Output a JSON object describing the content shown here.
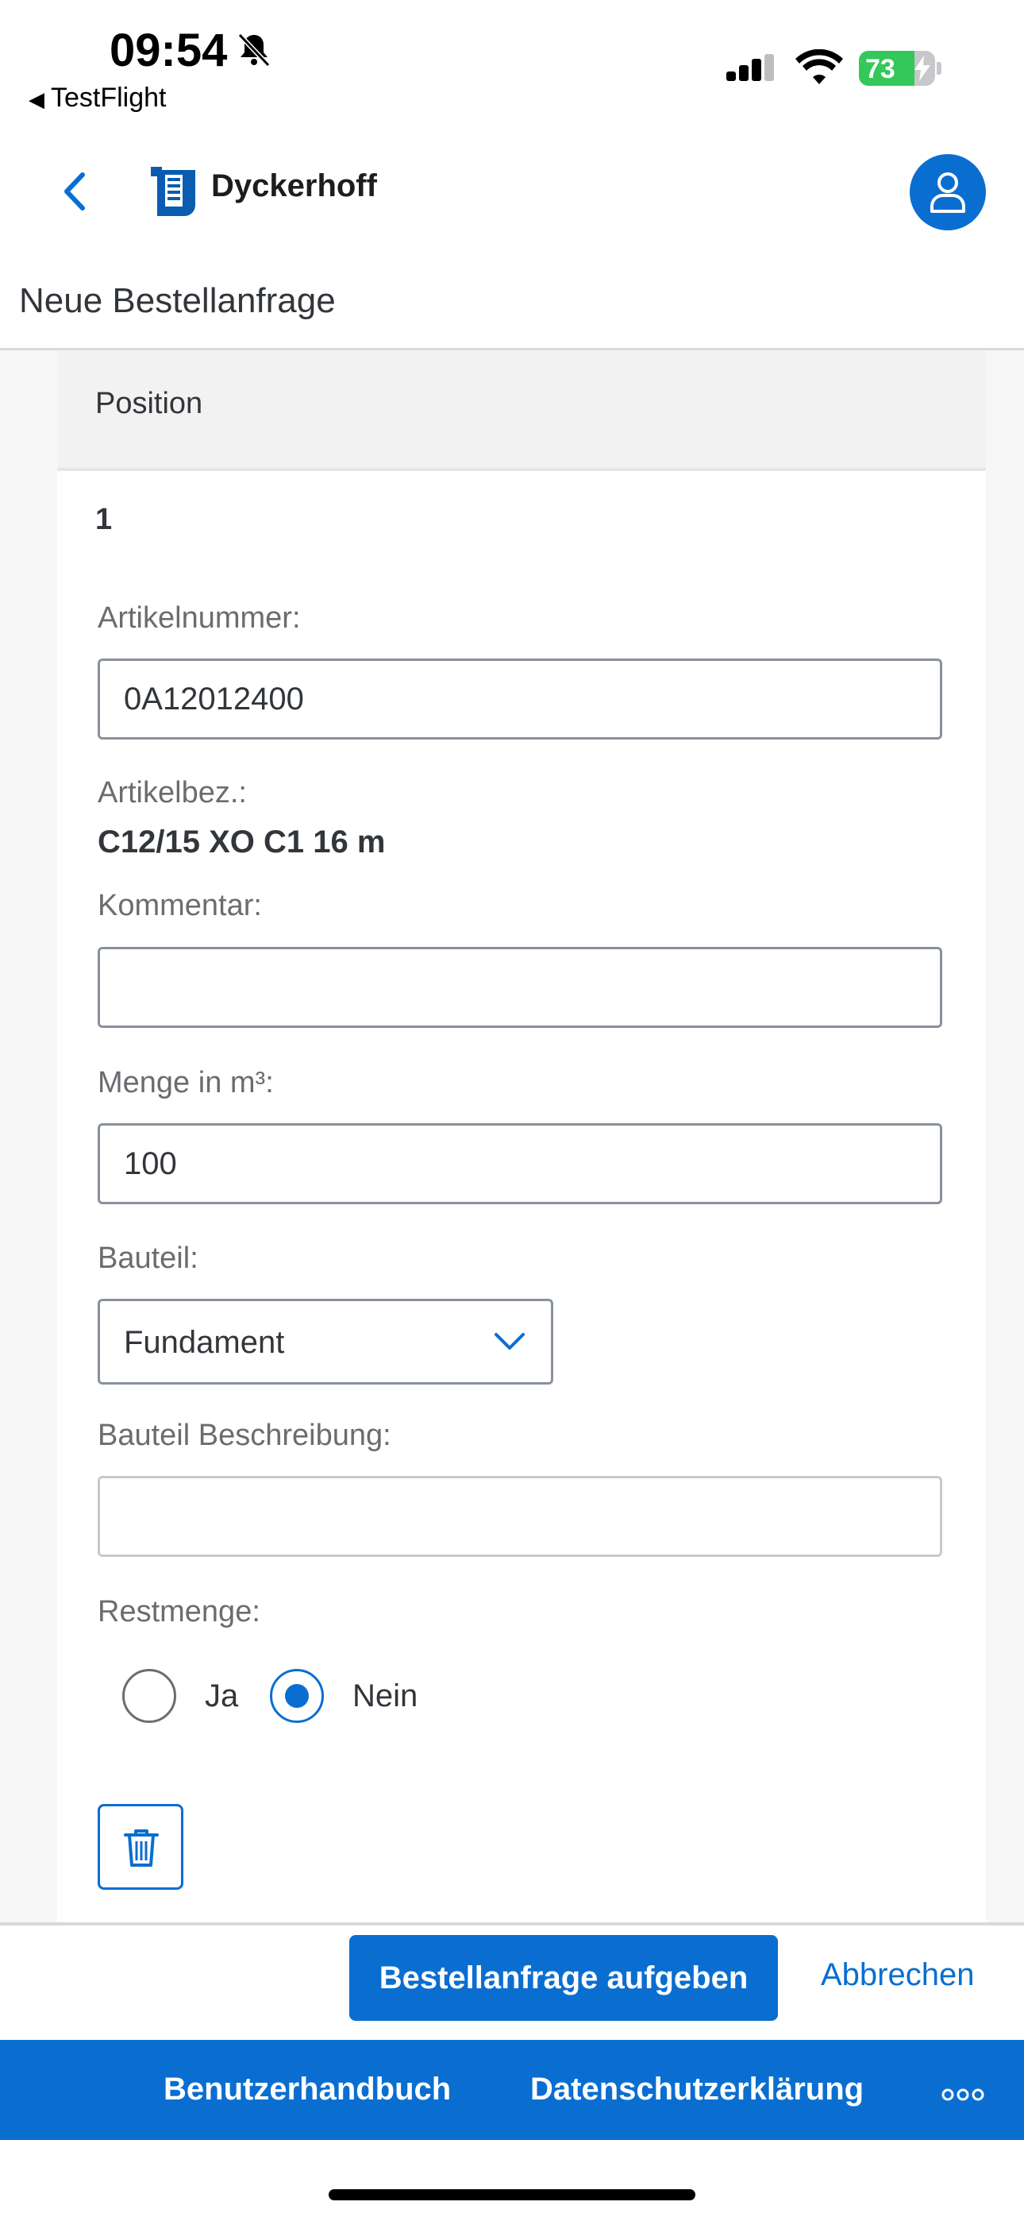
{
  "status_bar": {
    "time": "09:54",
    "back_app": "TestFlight",
    "battery_percent": 73
  },
  "header": {
    "brand": "Dyckerhoff",
    "icons": [
      "back-chevron-icon",
      "dyckerhoff-logo",
      "user-icon"
    ]
  },
  "page": {
    "title": "Neue Bestellanfrage"
  },
  "position": {
    "section_label": "Position",
    "number": "1",
    "artikelnummer_label": "Artikelnummer:",
    "artikelnummer_value": "0A12012400",
    "artikelbez_label": "Artikelbez.:",
    "artikelbez_value": "C12/15 XO C1 16 m",
    "kommentar_label": "Kommentar:",
    "kommentar_value": "",
    "menge_label": "Menge in m³:",
    "menge_value": "100",
    "bauteil_label": "Bauteil:",
    "bauteil_value": "Fundament",
    "bauteil_beschreibung_label": "Bauteil Beschreibung:",
    "bauteil_beschreibung_value": "",
    "restmenge_label": "Restmenge:",
    "restmenge_options": [
      "Ja",
      "Nein"
    ],
    "restmenge_selected": "Nein"
  },
  "actions": {
    "submit": "Bestellanfrage aufgeben",
    "cancel": "Abbrechen"
  },
  "footer": {
    "links": [
      "Benutzerhandbuch",
      "Datenschutzerklärung"
    ]
  },
  "colors": {
    "accent": "#0a6ed1",
    "battery": "#34c759"
  }
}
